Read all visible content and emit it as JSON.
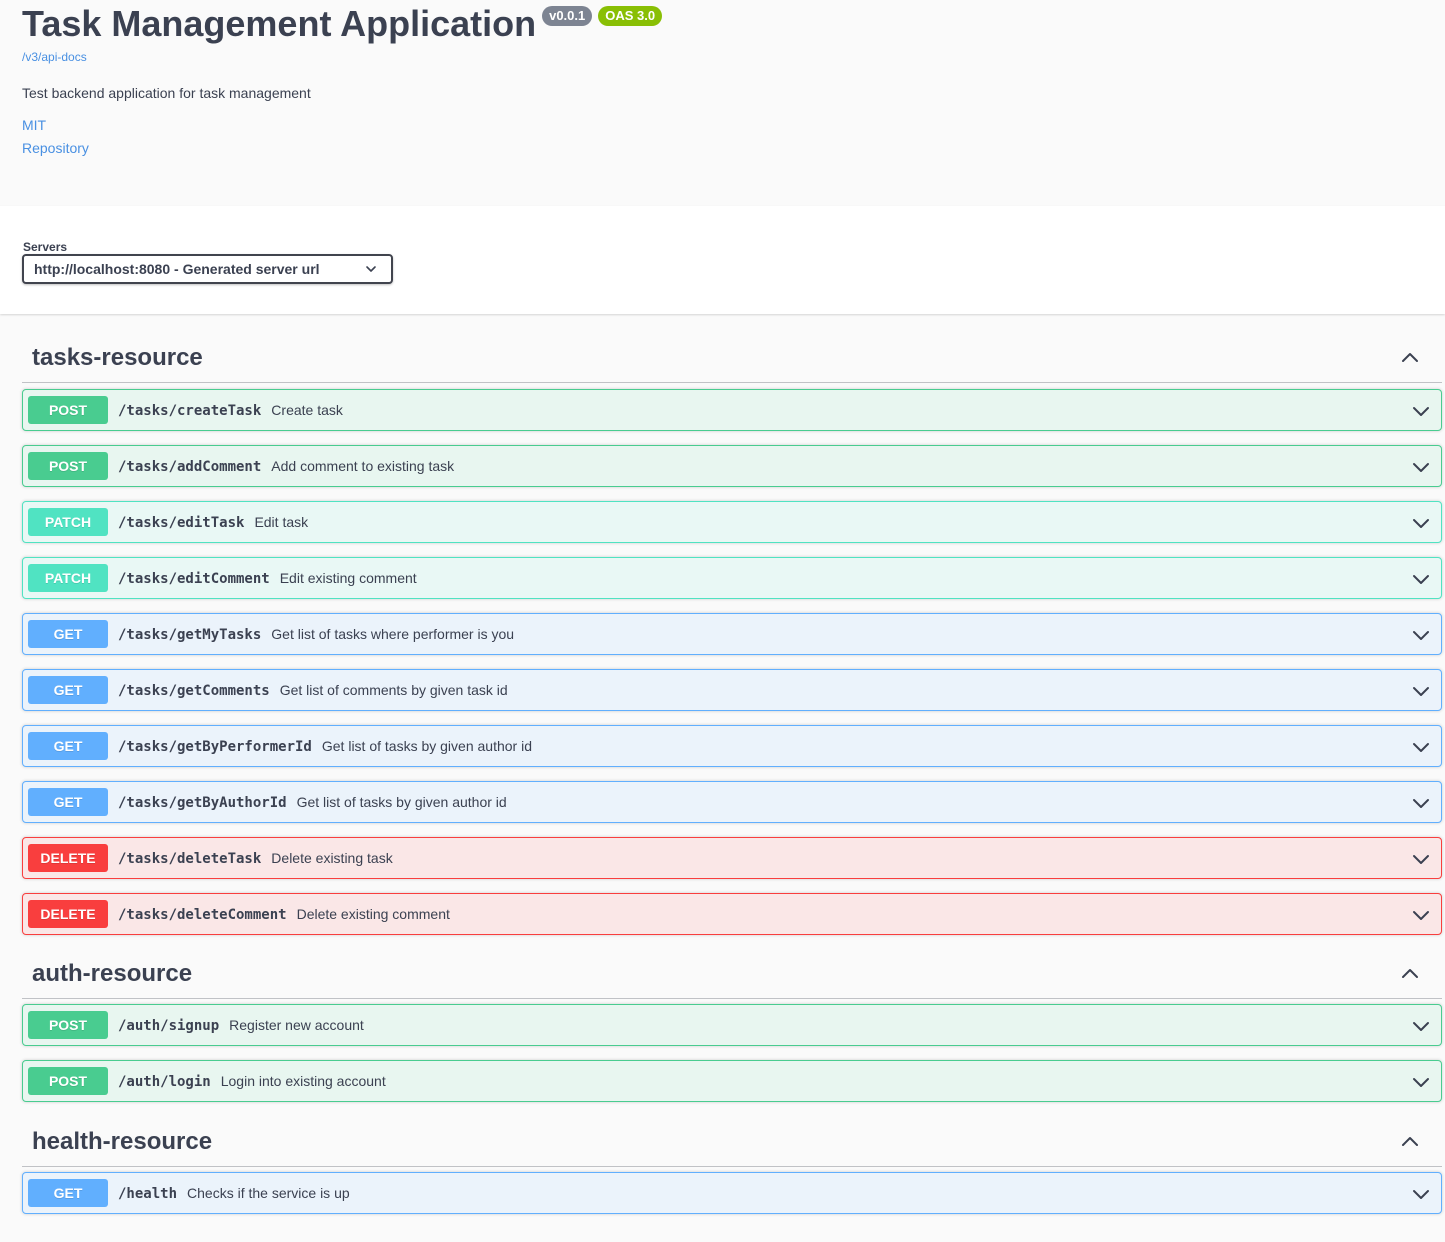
{
  "info": {
    "title": "Task Management Application",
    "version_badge": "v0.0.1",
    "oas_badge": "OAS 3.0",
    "spec_link": "/v3/api-docs",
    "description": "Test backend application for task management",
    "license_link": "MIT",
    "repository_link": "Repository"
  },
  "servers": {
    "label": "Servers",
    "selected": "http://localhost:8080 - Generated server url"
  },
  "sections": [
    {
      "name": "tasks-resource",
      "expanded": true,
      "operations": [
        {
          "method": "POST",
          "path": "/tasks/createTask",
          "summary": "Create task"
        },
        {
          "method": "POST",
          "path": "/tasks/addComment",
          "summary": "Add comment to existing task"
        },
        {
          "method": "PATCH",
          "path": "/tasks/editTask",
          "summary": "Edit task"
        },
        {
          "method": "PATCH",
          "path": "/tasks/editComment",
          "summary": "Edit existing comment"
        },
        {
          "method": "GET",
          "path": "/tasks/getMyTasks",
          "summary": "Get list of tasks where performer is you"
        },
        {
          "method": "GET",
          "path": "/tasks/getComments",
          "summary": "Get list of comments by given task id"
        },
        {
          "method": "GET",
          "path": "/tasks/getByPerformerId",
          "summary": "Get list of tasks by given author id"
        },
        {
          "method": "GET",
          "path": "/tasks/getByAuthorId",
          "summary": "Get list of tasks by given author id"
        },
        {
          "method": "DELETE",
          "path": "/tasks/deleteTask",
          "summary": "Delete existing task"
        },
        {
          "method": "DELETE",
          "path": "/tasks/deleteComment",
          "summary": "Delete existing comment"
        }
      ]
    },
    {
      "name": "auth-resource",
      "expanded": true,
      "operations": [
        {
          "method": "POST",
          "path": "/auth/signup",
          "summary": "Register new account"
        },
        {
          "method": "POST",
          "path": "/auth/login",
          "summary": "Login into existing account"
        }
      ]
    },
    {
      "name": "health-resource",
      "expanded": true,
      "operations": [
        {
          "method": "GET",
          "path": "/health",
          "summary": "Checks if the service is up"
        }
      ]
    }
  ],
  "colors": {
    "post": "#49cc90",
    "patch": "#50e3c2",
    "get": "#61affe",
    "delete": "#f93e3e",
    "link": "#4990e2",
    "version_badge": "#7d8492",
    "oas_badge": "#89bf04"
  },
  "icons": {
    "section_toggle": "chevron-up-icon",
    "operation_toggle": "chevron-down-icon",
    "select_toggle": "chevron-down-icon"
  }
}
